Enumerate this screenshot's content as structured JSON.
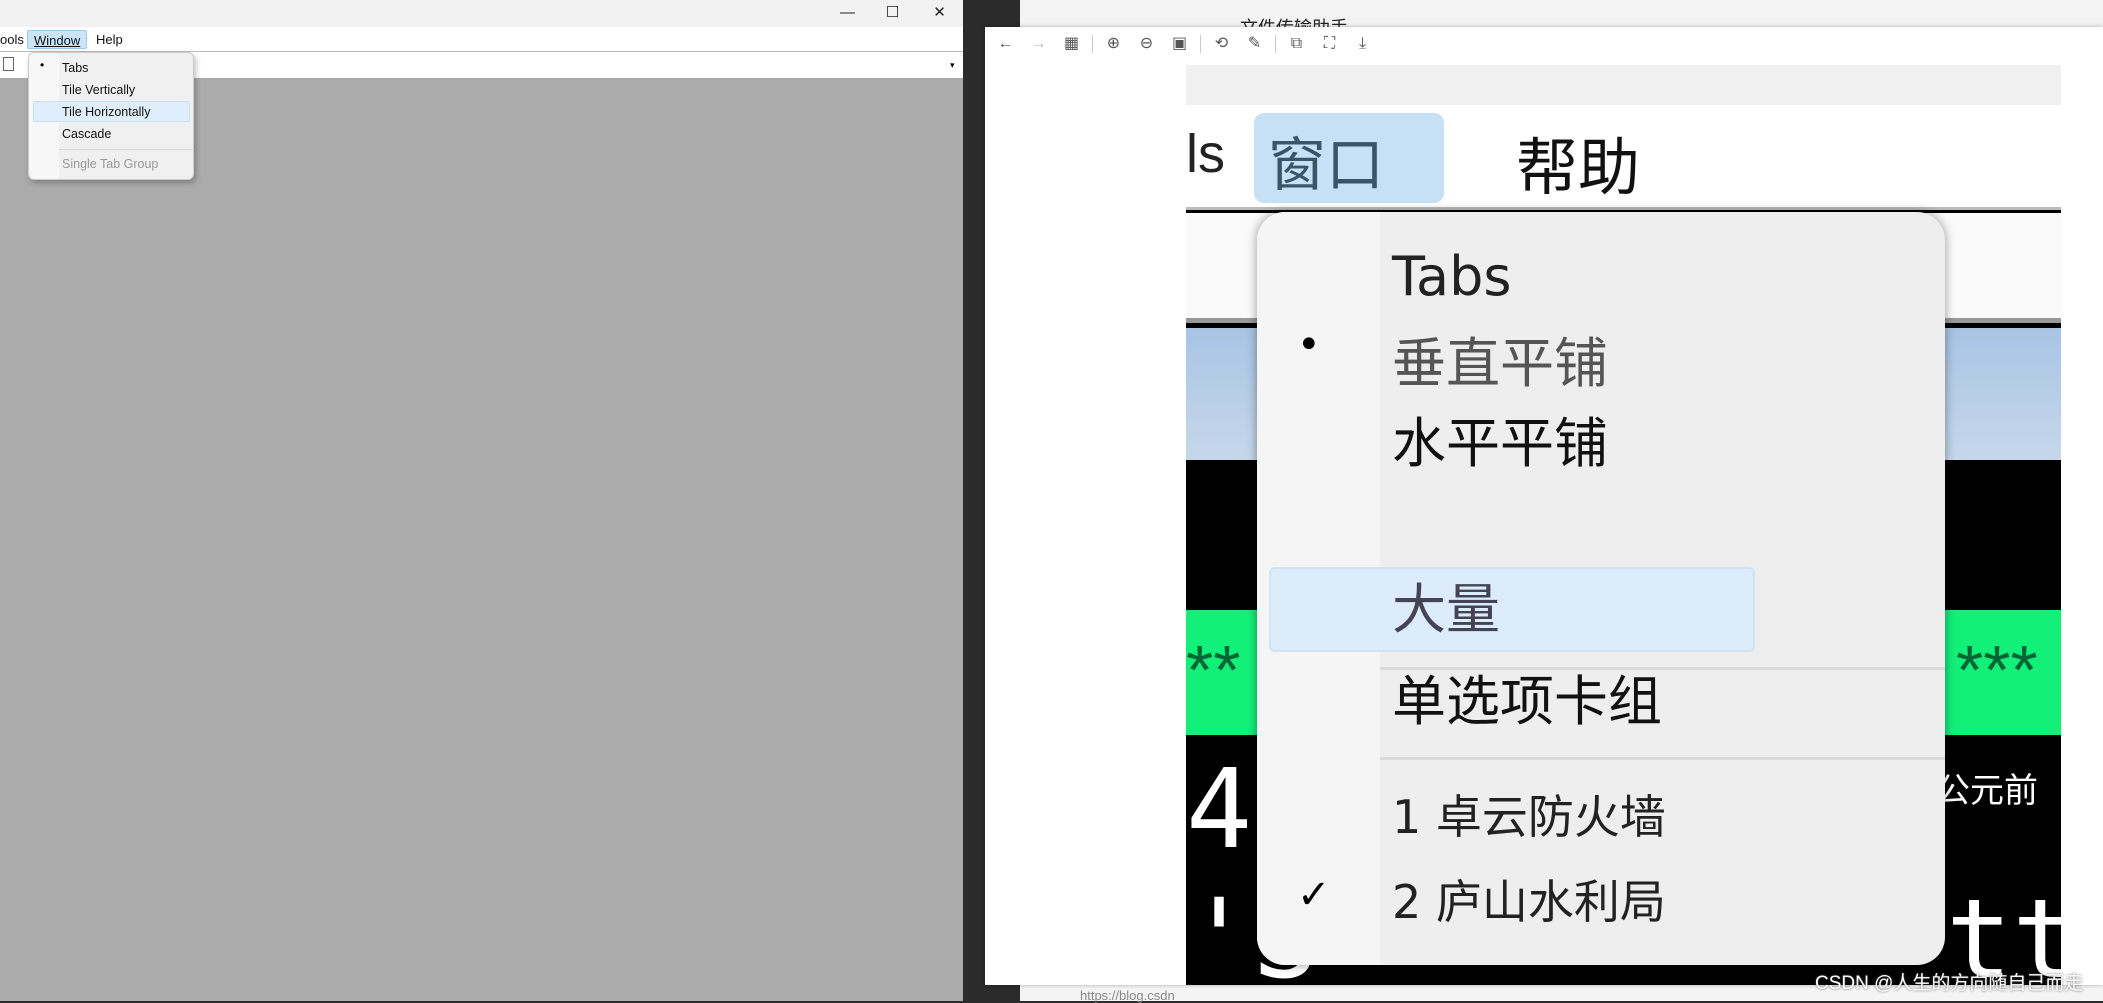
{
  "left_window": {
    "controls": {
      "minimize": "—",
      "maximize": "☐",
      "close": "✕"
    },
    "menubar": {
      "items": [
        {
          "label": "ools"
        },
        {
          "label": "Window"
        },
        {
          "label": "Help"
        }
      ]
    },
    "window_menu": {
      "items": [
        {
          "label": "Tabs",
          "bullet": "•"
        },
        {
          "label": "Tile Vertically"
        },
        {
          "label": "Tile Horizontally",
          "highlighted": true
        },
        {
          "label": "Cascade"
        },
        {
          "label": "Single Tab Group",
          "disabled": true
        }
      ]
    }
  },
  "background": {
    "chat_title": "文件传输助手",
    "link": "https://blog.csdn"
  },
  "viewer": {
    "toolbar": [
      "arrow-left-icon",
      "arrow-right-icon",
      "grid-icon",
      "zoom-in-icon",
      "zoom-out-icon",
      "fit-icon",
      "rotate-icon",
      "edit-icon",
      "translate-icon",
      "ocr-icon",
      "download-icon"
    ],
    "image": {
      "menubar": {
        "prev": "ls",
        "window": "窗口",
        "help": "帮助"
      },
      "menu": {
        "items": [
          {
            "label": "Tabs"
          },
          {
            "label": "垂直平铺",
            "bullet": "•"
          },
          {
            "label": "水平平铺"
          },
          {
            "label": "大量",
            "highlighted": true
          },
          {
            "label": "单选项卡组"
          },
          {
            "label": "1 卓云防火墙"
          },
          {
            "label": "2 庐山水利局",
            "check": "✓"
          }
        ]
      },
      "bg_text": {
        "stars_left": "**",
        "stars_right": "***",
        "digit": "4",
        "bottom": "'S",
        "bottom_right": "tt",
        "era": "公元前"
      }
    }
  },
  "watermark": "CSDN @人生的方向随自己而走"
}
